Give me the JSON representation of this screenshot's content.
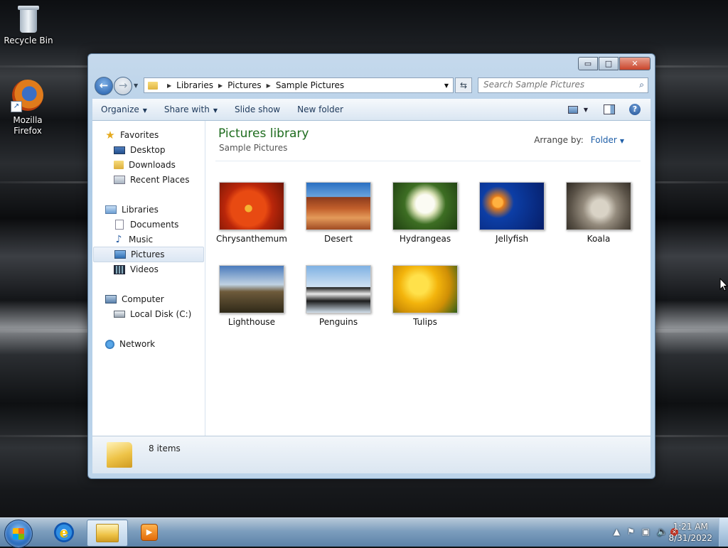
{
  "desktop": {
    "icons": [
      {
        "label": "Recycle Bin",
        "icon": "recycle-bin-icon"
      },
      {
        "label": "Mozilla Firefox",
        "icon": "firefox-icon"
      }
    ]
  },
  "window": {
    "controls": {
      "minimize": "▭",
      "maximize": "□",
      "close": "✕"
    },
    "address": {
      "crumbs": [
        "Libraries",
        "Pictures",
        "Sample Pictures"
      ]
    },
    "search": {
      "placeholder": "Search Sample Pictures"
    },
    "toolbar": {
      "organize": "Organize",
      "share_with": "Share with",
      "slide_show": "Slide show",
      "new_folder": "New folder"
    },
    "nav_pane": {
      "favorites": "Favorites",
      "desktop": "Desktop",
      "downloads": "Downloads",
      "recent_places": "Recent Places",
      "libraries": "Libraries",
      "documents": "Documents",
      "music": "Music",
      "pictures": "Pictures",
      "videos": "Videos",
      "computer": "Computer",
      "local_disk": "Local Disk (C:)",
      "network": "Network",
      "selected": "Pictures"
    },
    "content": {
      "title": "Pictures library",
      "subtitle": "Sample Pictures",
      "arrange_label": "Arrange by:",
      "arrange_value": "Folder",
      "items": [
        {
          "name": "Chrysanthemum"
        },
        {
          "name": "Desert"
        },
        {
          "name": "Hydrangeas"
        },
        {
          "name": "Jellyfish"
        },
        {
          "name": "Koala"
        },
        {
          "name": "Lighthouse"
        },
        {
          "name": "Penguins"
        },
        {
          "name": "Tulips"
        }
      ]
    },
    "details": {
      "item_count": "8 items"
    }
  },
  "taskbar": {
    "clock_time": "1:21 AM",
    "clock_date": "8/31/2022",
    "colors": {
      "start": "#2f72c4",
      "close_button": "#c9452b",
      "library_title": "#1e6c1e"
    }
  }
}
